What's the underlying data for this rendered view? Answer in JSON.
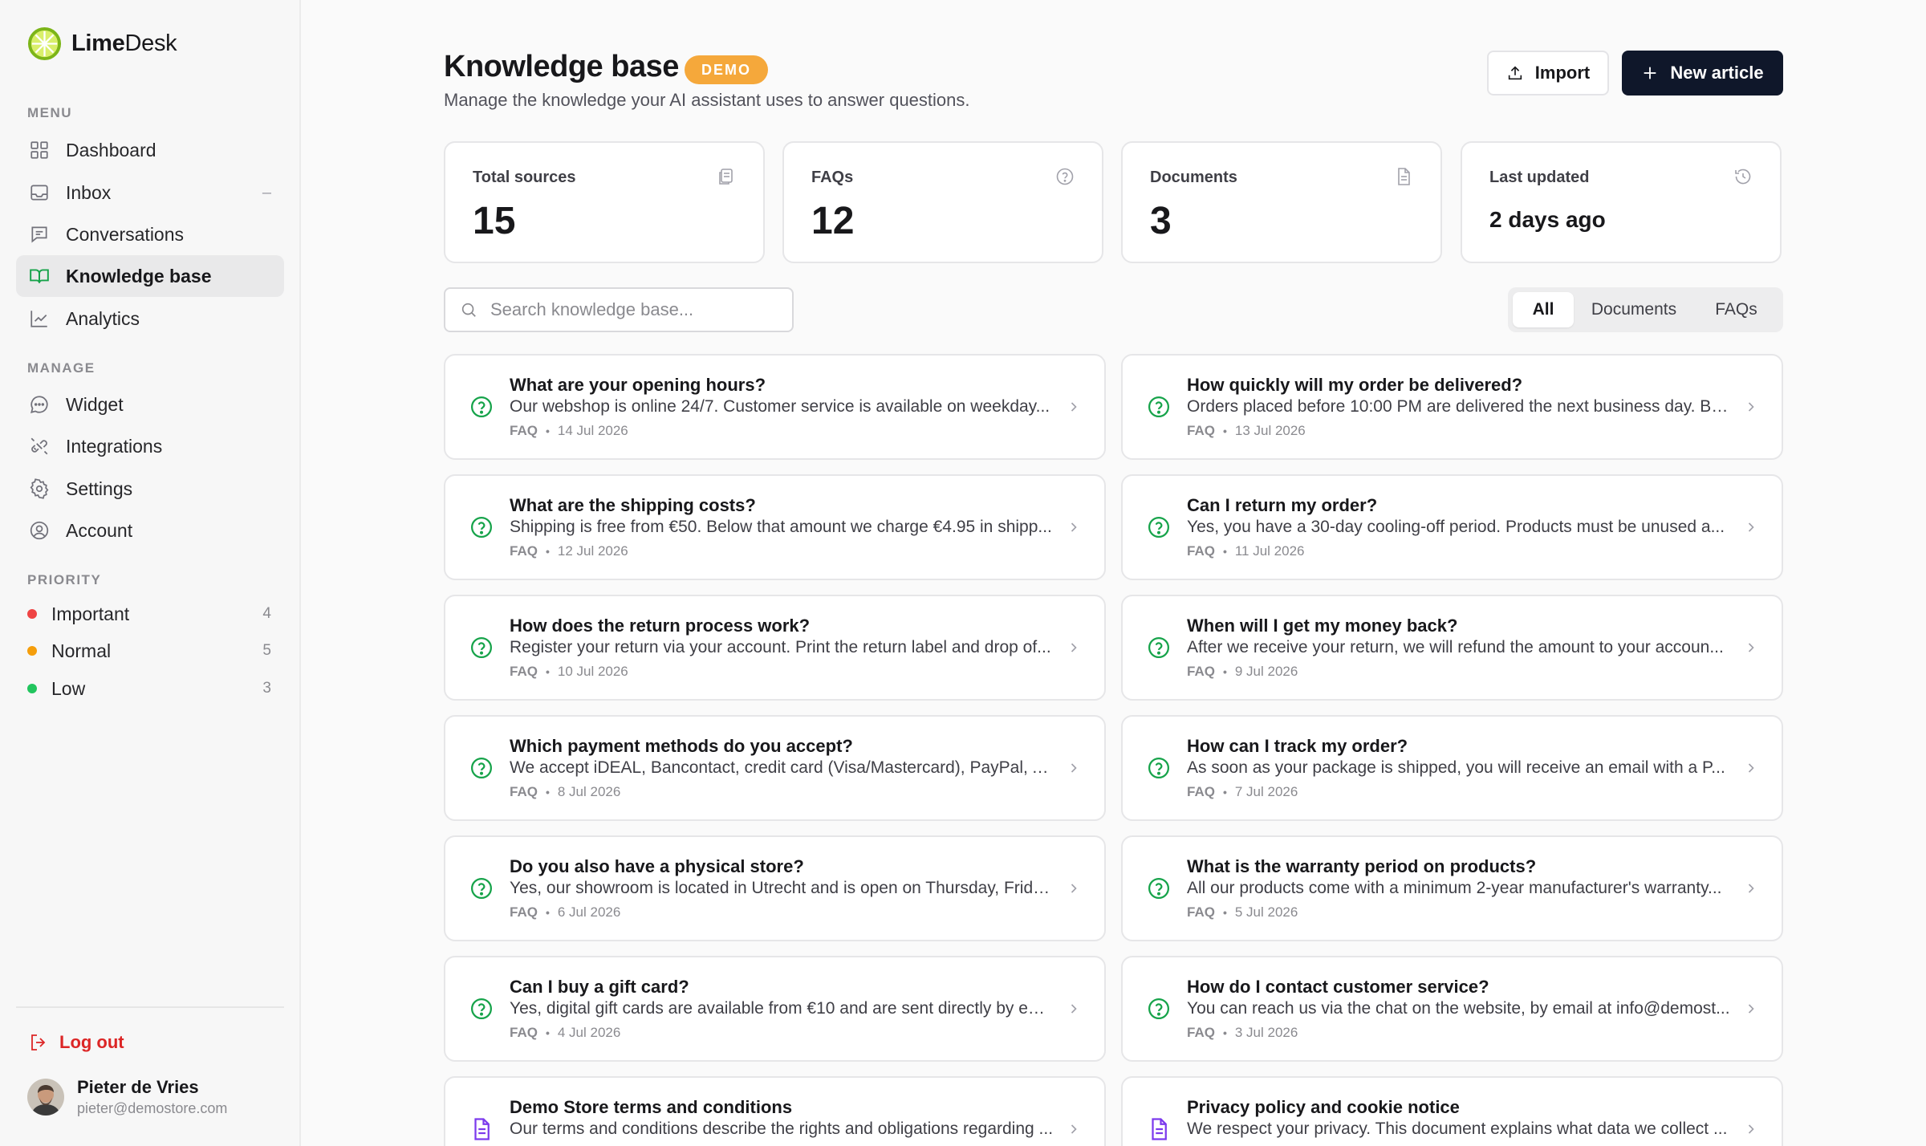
{
  "brand": {
    "name_bold": "Lime",
    "name_rest": "Desk"
  },
  "sidebar": {
    "menu_label": "MENU",
    "menu": [
      {
        "label": "Dashboard",
        "icon": "grid-icon"
      },
      {
        "label": "Inbox",
        "icon": "inbox-icon",
        "extra": "–"
      },
      {
        "label": "Conversations",
        "icon": "chat-icon"
      },
      {
        "label": "Knowledge base",
        "icon": "book-icon",
        "active": true
      },
      {
        "label": "Analytics",
        "icon": "chart-line-icon"
      }
    ],
    "manage_label": "MANAGE",
    "manage": [
      {
        "label": "Widget",
        "icon": "chat-bubble-icon"
      },
      {
        "label": "Integrations",
        "icon": "plug-icon"
      },
      {
        "label": "Settings",
        "icon": "gear-icon"
      },
      {
        "label": "Account",
        "icon": "user-circle-icon"
      }
    ],
    "priority_label": "PRIORITY",
    "priority": [
      {
        "label": "Important",
        "count": "4",
        "color": "#ef4444"
      },
      {
        "label": "Normal",
        "count": "5",
        "color": "#f59e0b"
      },
      {
        "label": "Low",
        "count": "3",
        "color": "#22c55e"
      }
    ],
    "logout": "Log out",
    "user": {
      "name": "Pieter de Vries",
      "email": "pieter@demostore.com"
    }
  },
  "header": {
    "title": "Knowledge base",
    "badge": "DEMO",
    "subtitle": "Manage the knowledge your AI assistant uses to answer questions.",
    "import_label": "Import",
    "new_label": "New article"
  },
  "stats": [
    {
      "label": "Total sources",
      "value": "15",
      "icon": "files-icon"
    },
    {
      "label": "FAQs",
      "value": "12",
      "icon": "question-circle-icon"
    },
    {
      "label": "Documents",
      "value": "3",
      "icon": "document-icon"
    },
    {
      "label": "Last updated",
      "value": "2 days ago",
      "icon": "history-icon"
    }
  ],
  "search": {
    "placeholder": "Search knowledge base..."
  },
  "filters": [
    {
      "label": "All",
      "active": true
    },
    {
      "label": "Documents"
    },
    {
      "label": "FAQs"
    }
  ],
  "articles": [
    {
      "title": "What are your opening hours?",
      "body": "Our webshop is online 24/7. Customer service is available on weekday...",
      "type": "FAQ",
      "date": "14 Jul 2026",
      "kind": "faq"
    },
    {
      "title": "How quickly will my order be delivered?",
      "body": "Orders placed before 10:00 PM are delivered the next business day. Be...",
      "type": "FAQ",
      "date": "13 Jul 2026",
      "kind": "faq"
    },
    {
      "title": "What are the shipping costs?",
      "body": "Shipping is free from €50. Below that amount we charge €4.95 in shipp...",
      "type": "FAQ",
      "date": "12 Jul 2026",
      "kind": "faq"
    },
    {
      "title": "Can I return my order?",
      "body": "Yes, you have a 30-day cooling-off period. Products must be unused a...",
      "type": "FAQ",
      "date": "11 Jul 2026",
      "kind": "faq"
    },
    {
      "title": "How does the return process work?",
      "body": "Register your return via your account. Print the return label and drop of...",
      "type": "FAQ",
      "date": "10 Jul 2026",
      "kind": "faq"
    },
    {
      "title": "When will I get my money back?",
      "body": "After we receive your return, we will refund the amount to your accoun...",
      "type": "FAQ",
      "date": "9 Jul 2026",
      "kind": "faq"
    },
    {
      "title": "Which payment methods do you accept?",
      "body": "We accept iDEAL, Bancontact, credit card (Visa/Mastercard), PayPal, A...",
      "type": "FAQ",
      "date": "8 Jul 2026",
      "kind": "faq"
    },
    {
      "title": "How can I track my order?",
      "body": "As soon as your package is shipped, you will receive an email with a P...",
      "type": "FAQ",
      "date": "7 Jul 2026",
      "kind": "faq"
    },
    {
      "title": "Do you also have a physical store?",
      "body": "Yes, our showroom is located in Utrecht and is open on Thursday, Frida...",
      "type": "FAQ",
      "date": "6 Jul 2026",
      "kind": "faq"
    },
    {
      "title": "What is the warranty period on products?",
      "body": "All our products come with a minimum 2-year manufacturer's warranty...",
      "type": "FAQ",
      "date": "5 Jul 2026",
      "kind": "faq"
    },
    {
      "title": "Can I buy a gift card?",
      "body": "Yes, digital gift cards are available from €10 and are sent directly by em...",
      "type": "FAQ",
      "date": "4 Jul 2026",
      "kind": "faq"
    },
    {
      "title": "How do I contact customer service?",
      "body": "You can reach us via the chat on the website, by email at info@demost...",
      "type": "FAQ",
      "date": "3 Jul 2026",
      "kind": "faq"
    },
    {
      "title": "Demo Store terms and conditions",
      "body": "Our terms and conditions describe the rights and obligations regarding ...",
      "type": "",
      "date": "",
      "kind": "doc"
    },
    {
      "title": "Privacy policy and cookie notice",
      "body": "We respect your privacy. This document explains what data we collect ...",
      "type": "",
      "date": "",
      "kind": "doc"
    }
  ],
  "colors": {
    "accent_green": "#16a34a",
    "doc_purple": "#7c3aed",
    "primary_dark": "#0f172a",
    "demo_orange": "#f5a83b",
    "logout_red": "#dc2626"
  }
}
